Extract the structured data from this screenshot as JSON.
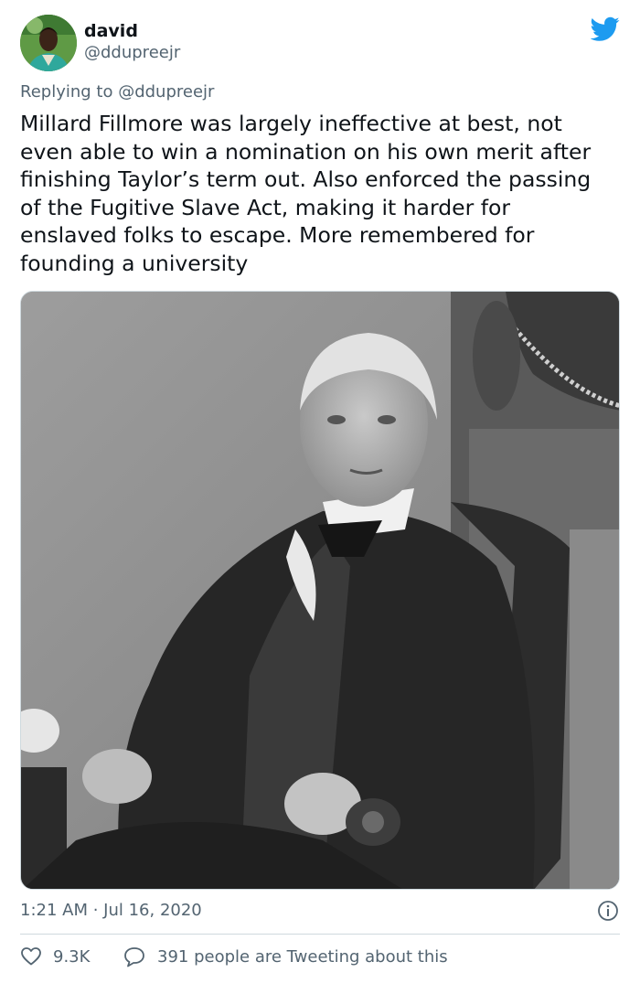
{
  "author": {
    "display_name": "david",
    "handle": "@ddupreejr"
  },
  "reply": {
    "prefix": "Replying to ",
    "mention": "@ddupreejr"
  },
  "tweet": {
    "text": "Millard Fillmore was largely ineffective at best, not\neven able to win a nomination on his own merit after\nfinishing Taylor’s term out. Also enforced the passing\nof the Fugitive Slave Act, making it harder for\nenslaved folks to escape. More remembered for\nfounding a university",
    "timestamp": "1:21 AM · Jul 16, 2020"
  },
  "stats": {
    "likes": "9.3K",
    "conversation": "391 people are Tweeting about this"
  },
  "colors": {
    "twitter_blue": "#1d9bf0",
    "secondary_text": "#536471",
    "border": "#cfd9de"
  },
  "icons": [
    "twitter-bird-icon",
    "info-icon",
    "heart-icon",
    "reply-bubble-icon"
  ]
}
